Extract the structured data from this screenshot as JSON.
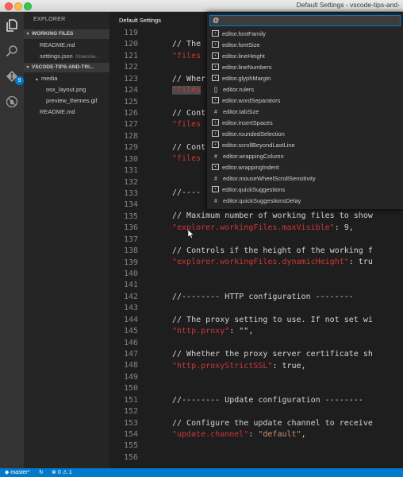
{
  "window": {
    "title": "Default Settings - vscode-tips-and-"
  },
  "activity": {
    "scm_badge": "9"
  },
  "sidebar": {
    "header": "EXPLORER",
    "working_files": {
      "label": "WORKING FILES",
      "items": [
        {
          "name": "README.md",
          "path": ""
        },
        {
          "name": "settings.json",
          "path": "/Users/w..."
        }
      ]
    },
    "project": {
      "label": "VSCODE-TIPS-AND-TRI...",
      "items": [
        {
          "name": "media"
        },
        {
          "name": "osx_layout.png"
        },
        {
          "name": "preview_themes.gif"
        },
        {
          "name": "README.md"
        }
      ]
    }
  },
  "tabs": [
    {
      "label": "Default Settings"
    }
  ],
  "editor": {
    "line_numbers": [
      "119",
      "120",
      "121",
      "122",
      "123",
      "124",
      "125",
      "126",
      "127",
      "128",
      "129",
      "130",
      "131",
      "132",
      "133",
      "134",
      "135",
      "136",
      "137",
      "138",
      "139",
      "140",
      "141",
      "142",
      "143",
      "144",
      "145",
      "146",
      "147",
      "148",
      "149",
      "150",
      "151",
      "152",
      "153",
      "154",
      "155",
      "156"
    ],
    "lines": {
      "l120": "// The",
      "l121": "\"files",
      "l123": "// Wher",
      "l124": "\"files",
      "l126": "// Cont",
      "l127": "\"files",
      "l129": "// Cont",
      "l130": "\"files",
      "l133": "//----",
      "l135": "// Maximum number of working files to show",
      "l136a": "\"explorer.workingFiles.maxVisible\"",
      "l136b": ": 9,",
      "l138": "// Controls if the height of the working f",
      "l139a": "\"explorer.workingFiles.dynamicHeight\"",
      "l139b": ": tru",
      "l142": "//-------- HTTP configuration --------",
      "l144": "// The proxy setting to use. If not set wi",
      "l145a": "\"http.proxy\"",
      "l145b": ": \"\",",
      "l147": "// Whether the proxy server certificate sh",
      "l148a": "\"http.proxyStrictSSL\"",
      "l148b": ": true,",
      "l151": "//-------- Update configuration --------",
      "l153": "// Configure the update channel to receive",
      "l154a": "\"update.channel\"",
      "l154b": ": ",
      "l154c": "\"default\"",
      "l154d": ","
    }
  },
  "quick_open": {
    "input_value": "@",
    "items": [
      {
        "icon": "box",
        "label": "editor.fontFamily"
      },
      {
        "icon": "box",
        "label": "editor.fontSize"
      },
      {
        "icon": "box",
        "label": "editor.lineHeight"
      },
      {
        "icon": "box",
        "label": "editor.lineNumbers"
      },
      {
        "icon": "box",
        "label": "editor.glyphMargin"
      },
      {
        "icon": "[]",
        "label": "editor.rulers"
      },
      {
        "icon": "box",
        "label": "editor.wordSeparators"
      },
      {
        "icon": "#",
        "label": "editor.tabSize"
      },
      {
        "icon": "box",
        "label": "editor.insertSpaces"
      },
      {
        "icon": "box",
        "label": "editor.roundedSelection"
      },
      {
        "icon": "box",
        "label": "editor.scrollBeyondLastLine"
      },
      {
        "icon": "#",
        "label": "editor.wrappingColumn"
      },
      {
        "icon": "box",
        "label": "editor.wrappingIndent"
      },
      {
        "icon": "#",
        "label": "editor.mouseWheelScrollSensitivity"
      },
      {
        "icon": "box",
        "label": "editor.quickSuggestions"
      },
      {
        "icon": "#",
        "label": "editor.quickSuggestionsDelay"
      }
    ]
  },
  "status": {
    "branch": "master*",
    "errors": "0",
    "warnings": "1"
  },
  "colors": {
    "accent": "#007acc",
    "string": "#ce3636",
    "string_value": "#ce9178"
  }
}
